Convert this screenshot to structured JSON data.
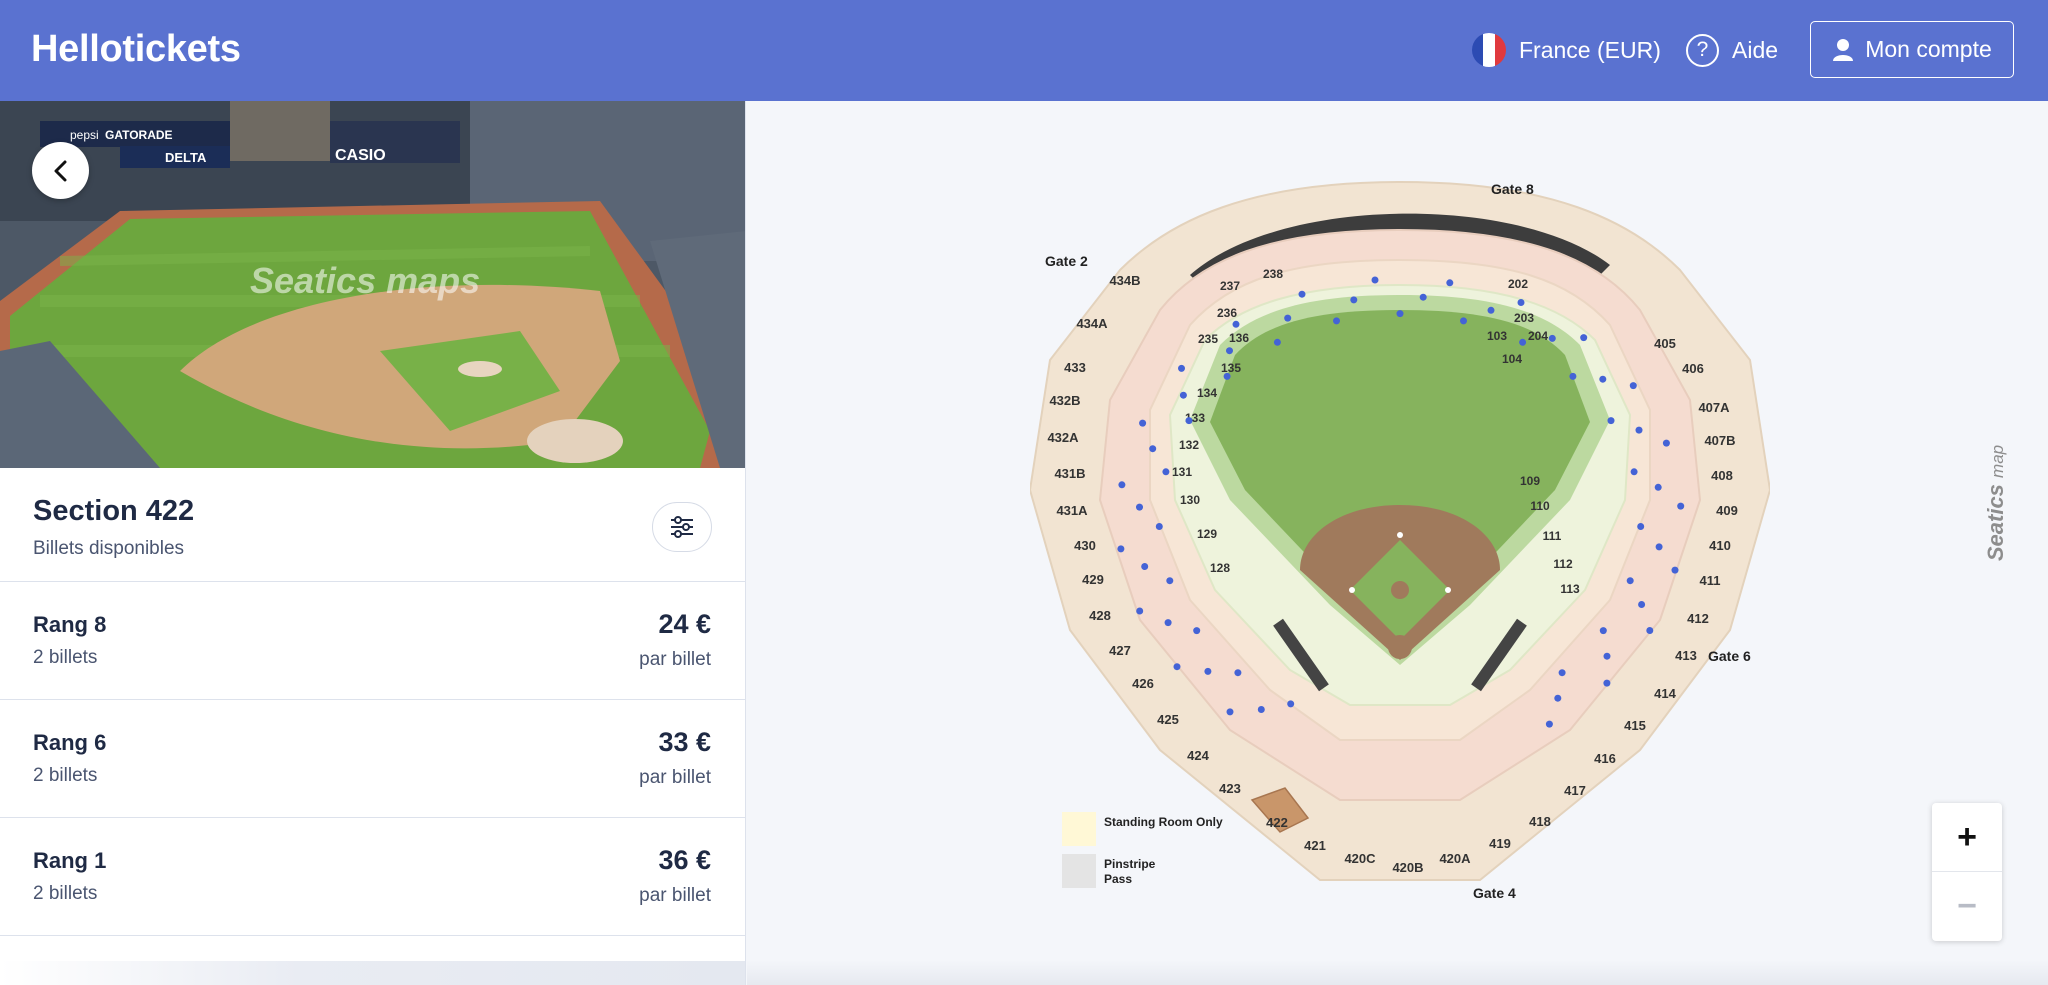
{
  "header": {
    "logo": "Hellotickets",
    "locale_label": "France (EUR)",
    "help_label": "Aide",
    "account_label": "Mon compte",
    "help_glyph": "?"
  },
  "photo": {
    "watermark": "Seatics maps",
    "ad_texts": [
      "pepsi",
      "GATORADE",
      "DELTA",
      "CASIO"
    ]
  },
  "section": {
    "title": "Section 422",
    "subtitle": "Billets disponibles"
  },
  "listings": [
    {
      "row": "Rang 8",
      "tickets": "2 billets",
      "price": "24 €",
      "unit": "par billet"
    },
    {
      "row": "Rang 6",
      "tickets": "2 billets",
      "price": "33 €",
      "unit": "par billet"
    },
    {
      "row": "Rang 1",
      "tickets": "2 billets",
      "price": "36 €",
      "unit": "par billet"
    }
  ],
  "map": {
    "gates": [
      "Gate 2",
      "Gate 8",
      "Gate 6",
      "Gate 4"
    ],
    "legend": [
      {
        "label": "Standing Room Only",
        "color": "#fff8d6"
      },
      {
        "label": "Pinstripe Pass",
        "color": "#e4e4e4"
      }
    ],
    "sections_outer": [
      "434B",
      "434A",
      "433",
      "432B",
      "432A",
      "431B",
      "431A",
      "430",
      "429",
      "428",
      "427",
      "426",
      "425",
      "424",
      "423",
      "422",
      "421",
      "420C",
      "420B",
      "420A",
      "419",
      "418",
      "417",
      "416",
      "415",
      "414",
      "413",
      "412",
      "411",
      "410",
      "409",
      "408",
      "407B",
      "407A",
      "406",
      "405"
    ],
    "sections_inner": [
      "237",
      "238",
      "202",
      "236",
      "235",
      "136",
      "203",
      "204",
      "103",
      "104",
      "135",
      "134",
      "133",
      "132",
      "131",
      "130",
      "129",
      "128",
      "109",
      "110",
      "111",
      "112",
      "113"
    ],
    "highlight_section": "422",
    "brand_text": "Seatics",
    "brand_suffix": "map",
    "zoom_in": "+",
    "zoom_out": "−"
  },
  "colors": {
    "header_bg": "#5a72d0",
    "field_green": "#86b35d",
    "infield_brown": "#a07a5c",
    "section_beige": "#f1e0cc",
    "highlight": "#c9966a",
    "dot_blue": "#4463d6"
  }
}
